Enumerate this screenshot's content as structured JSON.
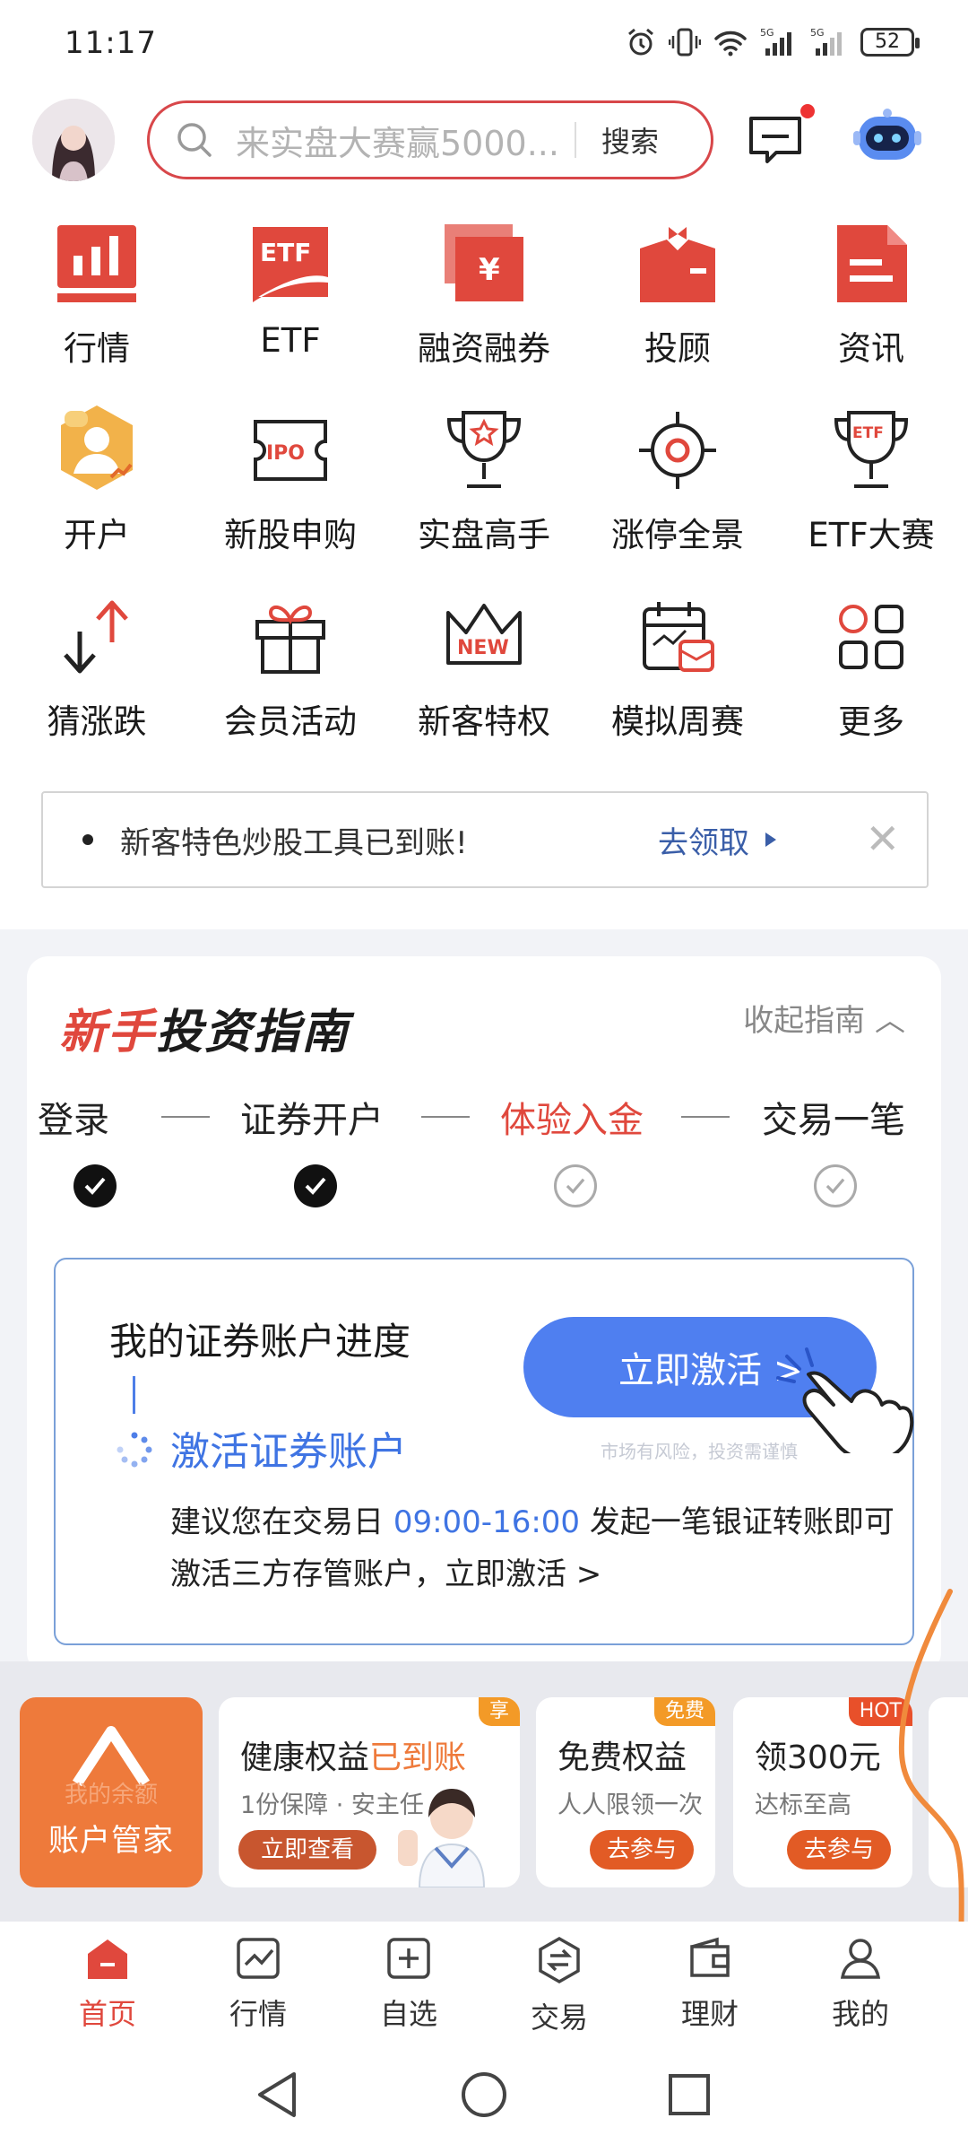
{
  "status_bar": {
    "time": "11:17",
    "battery": "52",
    "signal_1": "5G",
    "signal_2": "5G"
  },
  "header": {
    "search_placeholder": "来实盘大赛赢5000...",
    "search_button": "搜索"
  },
  "grid": [
    {
      "label": "行情",
      "icon": "market-chart-icon"
    },
    {
      "label": "ETF",
      "icon": "etf-icon"
    },
    {
      "label": "融资融券",
      "icon": "margin-trading-icon"
    },
    {
      "label": "投顾",
      "icon": "advisor-icon"
    },
    {
      "label": "资讯",
      "icon": "news-icon"
    },
    {
      "label": "开户",
      "icon": "open-account-icon"
    },
    {
      "label": "新股申购",
      "icon": "ipo-icon"
    },
    {
      "label": "实盘高手",
      "icon": "trophy-icon"
    },
    {
      "label": "涨停全景",
      "icon": "target-icon"
    },
    {
      "label": "ETF大赛",
      "icon": "etf-cup-icon"
    },
    {
      "label": "猜涨跌",
      "icon": "up-down-icon"
    },
    {
      "label": "会员活动",
      "icon": "gift-icon"
    },
    {
      "label": "新客特权",
      "icon": "new-crown-icon"
    },
    {
      "label": "模拟周赛",
      "icon": "calendar-icon"
    },
    {
      "label": "更多",
      "icon": "more-grid-icon"
    }
  ],
  "notice": {
    "text": "新客特色炒股工具已到账!",
    "link": "去领取"
  },
  "guide": {
    "title_red": "新手",
    "title_black": "投资指南",
    "collapse": "收起指南",
    "steps": [
      {
        "label": "登录",
        "done": true
      },
      {
        "label": "证券开户",
        "done": true
      },
      {
        "label": "体验入金",
        "done": false
      },
      {
        "label": "交易一笔",
        "done": false
      }
    ],
    "card": {
      "title": "我的证券账户进度",
      "status": "激活证券账户",
      "desc_before": "建议您在交易日 ",
      "desc_time": "09:00-16:00",
      "desc_after": " 发起一笔银证转账即可激活三方存管账户，立即激活 >",
      "button": "立即激活 >",
      "risk": "市场有风险，投资需谨慎"
    }
  },
  "banners": {
    "account": {
      "label": "账户管家",
      "faint": "我的余额"
    },
    "cards": [
      {
        "title": "健康权益",
        "title_accent": "已到账",
        "subtitle": "1份保障 · 安主任",
        "button": "立即查看",
        "tag": "享"
      },
      {
        "title": "免费权益",
        "title_accent": "",
        "subtitle": "人人限领一次",
        "button": "去参与",
        "tag": "免费"
      },
      {
        "title": "领300元",
        "title_accent": "",
        "subtitle": "达标至高",
        "button": "去参与",
        "tag": "HOT"
      }
    ]
  },
  "tabs": [
    {
      "label": "首页",
      "icon": "home-icon",
      "active": true
    },
    {
      "label": "行情",
      "icon": "market-icon",
      "active": false
    },
    {
      "label": "自选",
      "icon": "watchlist-icon",
      "active": false
    },
    {
      "label": "交易",
      "icon": "trade-icon",
      "active": false
    },
    {
      "label": "理财",
      "icon": "wallet-icon",
      "active": false
    },
    {
      "label": "我的",
      "icon": "profile-icon",
      "active": false
    }
  ],
  "colors": {
    "accent": "#e0483d",
    "blue": "#4f7ff0",
    "orange": "#ee7a3b"
  }
}
